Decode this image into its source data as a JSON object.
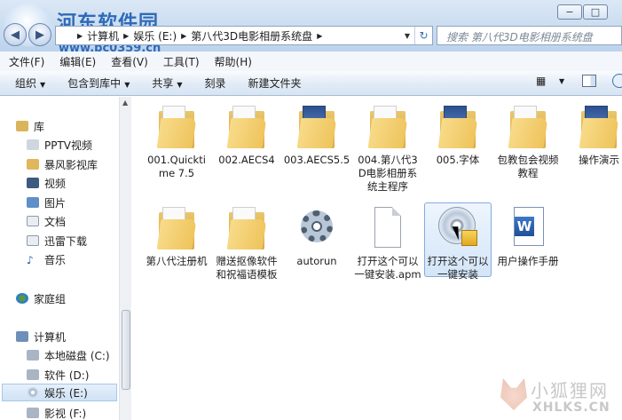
{
  "window": {
    "min_label": "−",
    "max_label": "□",
    "close_label": "✕"
  },
  "watermark": {
    "title": "河东软件园",
    "url": "www.pc0359.cn"
  },
  "address": {
    "segments": [
      "计算机",
      "娱乐 (E:)",
      "第八代3D电影相册系统盘"
    ],
    "search_placeholder": "搜索 第八代3D电影相册系统盘"
  },
  "menu": [
    "文件(F)",
    "编辑(E)",
    "查看(V)",
    "工具(T)",
    "帮助(H)"
  ],
  "toolbar": {
    "organize": "组织",
    "include_library": "包含到库中",
    "share": "共享",
    "burn": "刻录",
    "new_folder": "新建文件夹"
  },
  "nav": {
    "library": "库",
    "pptv": "PPTV视频",
    "baofeng": "暴风影视库",
    "video": "视频",
    "pictures": "图片",
    "docs": "文档",
    "xunlei": "迅雷下载",
    "music": "音乐",
    "homegroup": "家庭组",
    "computer": "计算机",
    "drive_c": "本地磁盘 (C:)",
    "drive_d": "软件 (D:)",
    "drive_e": "娱乐 (E:)",
    "drive_f": "影视 (F:)"
  },
  "files": [
    {
      "name": "001.Quicktime 7.5",
      "type": "folder"
    },
    {
      "name": "002.AECS4",
      "type": "folder"
    },
    {
      "name": "003.AECS5.5",
      "type": "folder"
    },
    {
      "name": "004.第八代3D电影相册系统主程序",
      "type": "folder"
    },
    {
      "name": "005.字体",
      "type": "folder"
    },
    {
      "name": "包教包会视频教程",
      "type": "folder"
    },
    {
      "name": "操作演示",
      "type": "folder"
    },
    {
      "name": "第八代注册机",
      "type": "folder"
    },
    {
      "name": "赠送抠像软件和祝福语模板",
      "type": "folder"
    },
    {
      "name": "autorun",
      "type": "settings-file"
    },
    {
      "name": "打开这个可以一键安装.apm",
      "type": "blank-file"
    },
    {
      "name": "打开这个可以一键安装",
      "type": "installer"
    },
    {
      "name": "用户操作手册",
      "type": "word-doc"
    }
  ],
  "watermark_bottom": {
    "title": "小狐狸网",
    "url": "XHLKS.CN"
  }
}
